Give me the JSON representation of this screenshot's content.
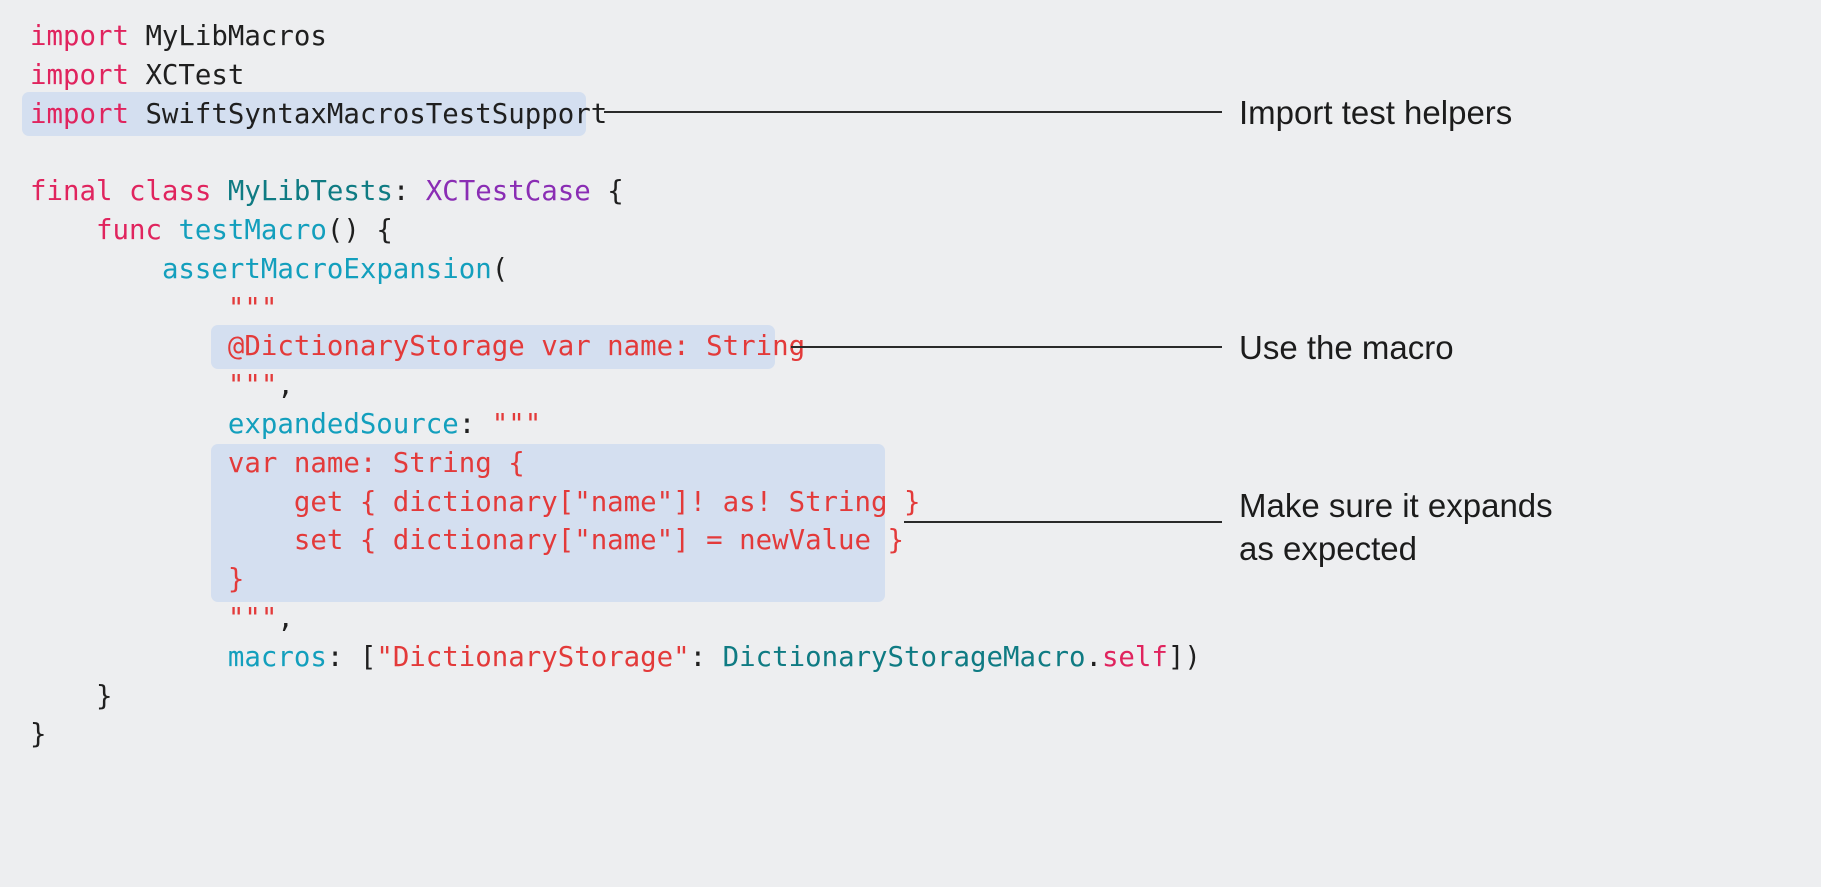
{
  "colors": {
    "background": "#edeef0",
    "highlight": "#d4dff0",
    "keyword": "#e0245e",
    "type_declaration": "#0f7b83",
    "type_reference": "#8a2db4",
    "function": "#139fbd",
    "string": "#e33a3a",
    "plain": "#1f1f1f"
  },
  "code_lines": [
    [
      {
        "t": "import",
        "k": "kw"
      },
      {
        "t": " MyLibMacros",
        "k": "plain"
      }
    ],
    [
      {
        "t": "import",
        "k": "kw"
      },
      {
        "t": " XCTest",
        "k": "plain"
      }
    ],
    [
      {
        "t": "import",
        "k": "kw"
      },
      {
        "t": " SwiftSyntaxMacrosTestSupport",
        "k": "plain"
      }
    ],
    [],
    [
      {
        "t": "final",
        "k": "kw"
      },
      {
        "t": " ",
        "k": "plain"
      },
      {
        "t": "class",
        "k": "kw"
      },
      {
        "t": " ",
        "k": "plain"
      },
      {
        "t": "MyLibTests",
        "k": "tdef"
      },
      {
        "t": ": ",
        "k": "plain"
      },
      {
        "t": "XCTestCase",
        "k": "ttyp"
      },
      {
        "t": " {",
        "k": "plain"
      }
    ],
    [
      {
        "t": "    ",
        "k": "plain"
      },
      {
        "t": "func",
        "k": "kw"
      },
      {
        "t": " ",
        "k": "plain"
      },
      {
        "t": "testMacro",
        "k": "fn"
      },
      {
        "t": "() {",
        "k": "plain"
      }
    ],
    [
      {
        "t": "        ",
        "k": "plain"
      },
      {
        "t": "assertMacroExpansion",
        "k": "fn"
      },
      {
        "t": "(",
        "k": "plain"
      }
    ],
    [
      {
        "t": "            ",
        "k": "plain"
      },
      {
        "t": "\"\"\"",
        "k": "str"
      }
    ],
    [
      {
        "t": "            ",
        "k": "plain"
      },
      {
        "t": "@DictionaryStorage var name: String",
        "k": "str"
      }
    ],
    [
      {
        "t": "            ",
        "k": "plain"
      },
      {
        "t": "\"\"\"",
        "k": "str"
      },
      {
        "t": ",",
        "k": "plain"
      }
    ],
    [
      {
        "t": "            ",
        "k": "plain"
      },
      {
        "t": "expandedSource",
        "k": "fn"
      },
      {
        "t": ": ",
        "k": "plain"
      },
      {
        "t": "\"\"\"",
        "k": "str"
      }
    ],
    [
      {
        "t": "            ",
        "k": "plain"
      },
      {
        "t": "var name: String {",
        "k": "str"
      }
    ],
    [
      {
        "t": "                ",
        "k": "plain"
      },
      {
        "t": "get { dictionary[\"name\"]! as! String }",
        "k": "str"
      }
    ],
    [
      {
        "t": "                ",
        "k": "plain"
      },
      {
        "t": "set { dictionary[\"name\"] = newValue }",
        "k": "str"
      }
    ],
    [
      {
        "t": "            ",
        "k": "plain"
      },
      {
        "t": "}",
        "k": "str"
      }
    ],
    [
      {
        "t": "            ",
        "k": "plain"
      },
      {
        "t": "\"\"\"",
        "k": "str"
      },
      {
        "t": ",",
        "k": "plain"
      }
    ],
    [
      {
        "t": "            ",
        "k": "plain"
      },
      {
        "t": "macros",
        "k": "fn"
      },
      {
        "t": ": [",
        "k": "plain"
      },
      {
        "t": "\"DictionaryStorage\"",
        "k": "str"
      },
      {
        "t": ": ",
        "k": "plain"
      },
      {
        "t": "DictionaryStorageMacro",
        "k": "tdef"
      },
      {
        "t": ".",
        "k": "plain"
      },
      {
        "t": "self",
        "k": "kw"
      },
      {
        "t": "])",
        "k": "plain"
      }
    ],
    [
      {
        "t": "    }",
        "k": "plain"
      }
    ],
    [
      {
        "t": "}",
        "k": "plain"
      }
    ]
  ],
  "callouts": {
    "import_helpers": "Import test helpers",
    "use_macro": "Use the macro",
    "expands_line1": "Make sure it expands",
    "expands_line2": "as expected"
  }
}
